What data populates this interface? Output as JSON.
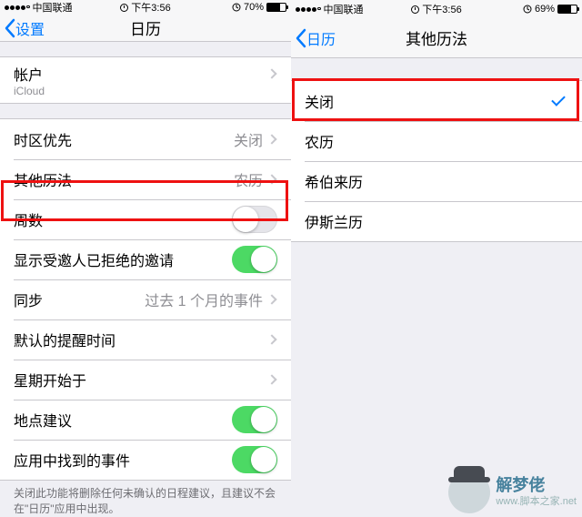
{
  "left": {
    "status": {
      "carrier": "中国联通",
      "time": "下午3:56",
      "battery_pct": "70%",
      "battery_fill": 70
    },
    "nav": {
      "back": "设置",
      "title": "日历"
    },
    "account": {
      "label": "帐户",
      "sub": "iCloud"
    },
    "rows": {
      "timezone": {
        "label": "时区优先",
        "value": "关闭"
      },
      "alt_cal": {
        "label": "其他历法",
        "value": "农历"
      },
      "week_num": {
        "label": "周数",
        "on": false
      },
      "declined": {
        "label": "显示受邀人已拒绝的邀请",
        "on": true
      },
      "sync": {
        "label": "同步",
        "value": "过去 1 个月的事件"
      },
      "default_alert": {
        "label": "默认的提醒时间"
      },
      "week_start": {
        "label": "星期开始于"
      },
      "location": {
        "label": "地点建议",
        "on": true
      },
      "found_in_apps": {
        "label": "应用中找到的事件",
        "on": true
      }
    },
    "footer": "关闭此功能将删除任何未确认的日程建议，且建议不会在\"日历\"应用中出现。"
  },
  "right": {
    "status": {
      "carrier": "中国联通",
      "time": "下午3:56",
      "battery_pct": "69%",
      "battery_fill": 69
    },
    "nav": {
      "back": "日历",
      "title": "其他历法"
    },
    "options": [
      {
        "label": "关闭",
        "checked": true
      },
      {
        "label": "农历",
        "checked": false
      },
      {
        "label": "希伯来历",
        "checked": false
      },
      {
        "label": "伊斯兰历",
        "checked": false
      }
    ]
  },
  "watermark": {
    "main": "解梦佬",
    "sub": "www.脚本之家.net"
  }
}
